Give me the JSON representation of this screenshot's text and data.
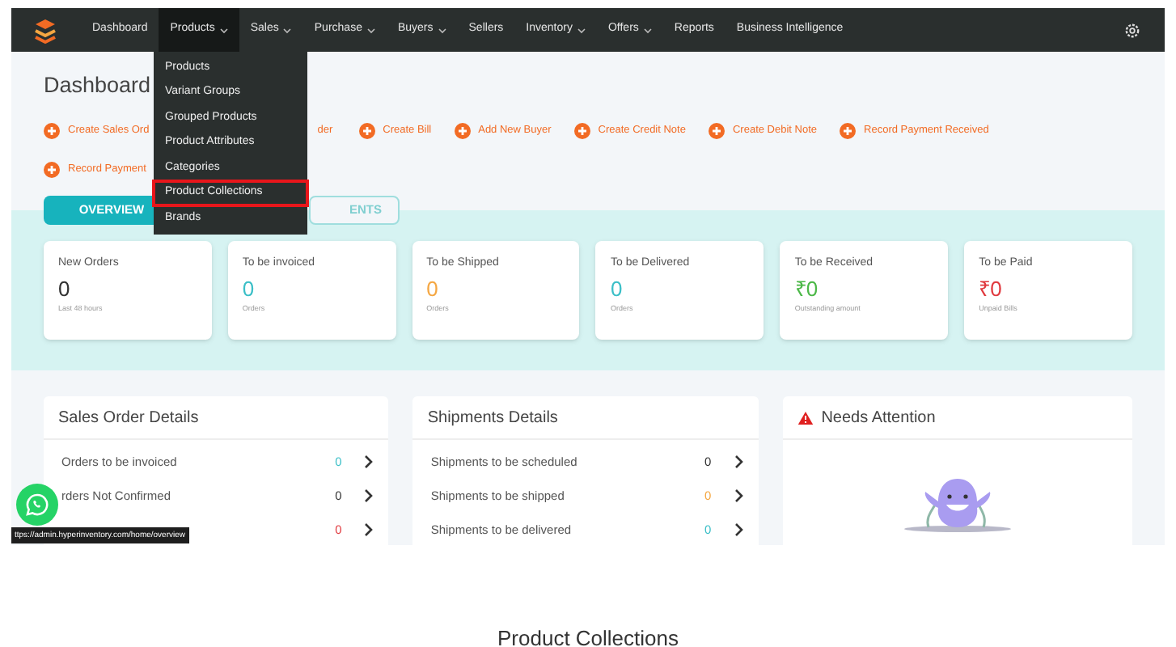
{
  "nav": {
    "items": [
      {
        "label": "Dashboard",
        "has_menu": false,
        "selected": false
      },
      {
        "label": "Products",
        "has_menu": true,
        "selected": true
      },
      {
        "label": "Sales",
        "has_menu": true,
        "selected": false
      },
      {
        "label": "Purchase",
        "has_menu": true,
        "selected": false
      },
      {
        "label": "Buyers",
        "has_menu": true,
        "selected": false
      },
      {
        "label": "Sellers",
        "has_menu": false,
        "selected": false
      },
      {
        "label": "Inventory",
        "has_menu": true,
        "selected": false
      },
      {
        "label": "Offers",
        "has_menu": true,
        "selected": false
      },
      {
        "label": "Reports",
        "has_menu": false,
        "selected": false
      },
      {
        "label": "Business Intelligence",
        "has_menu": false,
        "selected": false
      }
    ]
  },
  "dropdown": {
    "items": [
      {
        "label": "Products",
        "selected": false
      },
      {
        "label": "Variant Groups",
        "selected": false
      },
      {
        "label": "Grouped Products",
        "selected": false
      },
      {
        "label": "Product Attributes",
        "selected": false
      },
      {
        "label": "Categories",
        "selected": false
      },
      {
        "label": "Product Collections",
        "selected": true
      },
      {
        "label": "Brands",
        "selected": false
      }
    ]
  },
  "page_title": "Dashboard",
  "quick_actions": [
    [
      {
        "kind": "action",
        "label": "Create Sales Ord"
      },
      {
        "kind": "fragment",
        "label": "der"
      },
      {
        "kind": "action",
        "label": "Create Bill"
      },
      {
        "kind": "action",
        "label": "Add New Buyer"
      },
      {
        "kind": "action",
        "label": "Create Credit Note"
      },
      {
        "kind": "action",
        "label": "Create Debit Note"
      },
      {
        "kind": "action",
        "label": "Record Payment Received"
      }
    ],
    [
      {
        "kind": "action",
        "label": "Record Payment"
      }
    ]
  ],
  "tabs": [
    {
      "label": "OVERVIEW",
      "selected": true
    },
    {
      "label": "ENTS",
      "selected": false
    }
  ],
  "cards": [
    {
      "title": "New Orders",
      "value": "0",
      "caption": "Last 48 hours",
      "color": "#333333"
    },
    {
      "title": "To be invoiced",
      "value": "0",
      "caption": "Orders",
      "color": "#3bbfc7"
    },
    {
      "title": "To be Shipped",
      "value": "0",
      "caption": "Orders",
      "color": "#f5a742"
    },
    {
      "title": "To be Delivered",
      "value": "0",
      "caption": "Orders",
      "color": "#3bbfc7"
    },
    {
      "title": "To be Received",
      "value": "₹0",
      "caption": "Outstanding amount",
      "color": "#4cb848"
    },
    {
      "title": "To be Paid",
      "value": "₹0",
      "caption": "Unpaid Bills",
      "color": "#e0393e"
    }
  ],
  "panels": [
    {
      "kind": "list",
      "title": "Sales Order Details",
      "rows": [
        {
          "label": "Orders to be invoiced",
          "value": "0",
          "color": "#3bbfc7"
        },
        {
          "label": "rders Not Confirmed",
          "value": "0",
          "color": "#333333"
        },
        {
          "value": "0",
          "color": "#e0393e"
        }
      ]
    },
    {
      "kind": "list",
      "title": "Shipments Details",
      "rows": [
        {
          "label": "Shipments to be scheduled",
          "value": "0",
          "color": "#333333"
        },
        {
          "label": "Shipments to be shipped",
          "value": "0",
          "color": "#f5a742"
        },
        {
          "label": "Shipments to be delivered",
          "value": "0",
          "color": "#3bbfc7"
        }
      ]
    },
    {
      "kind": "attention",
      "title": "Needs Attention"
    }
  ],
  "status_url": "ttps://admin.hyperinventory.com/home/overview",
  "caption": "Product Collections"
}
